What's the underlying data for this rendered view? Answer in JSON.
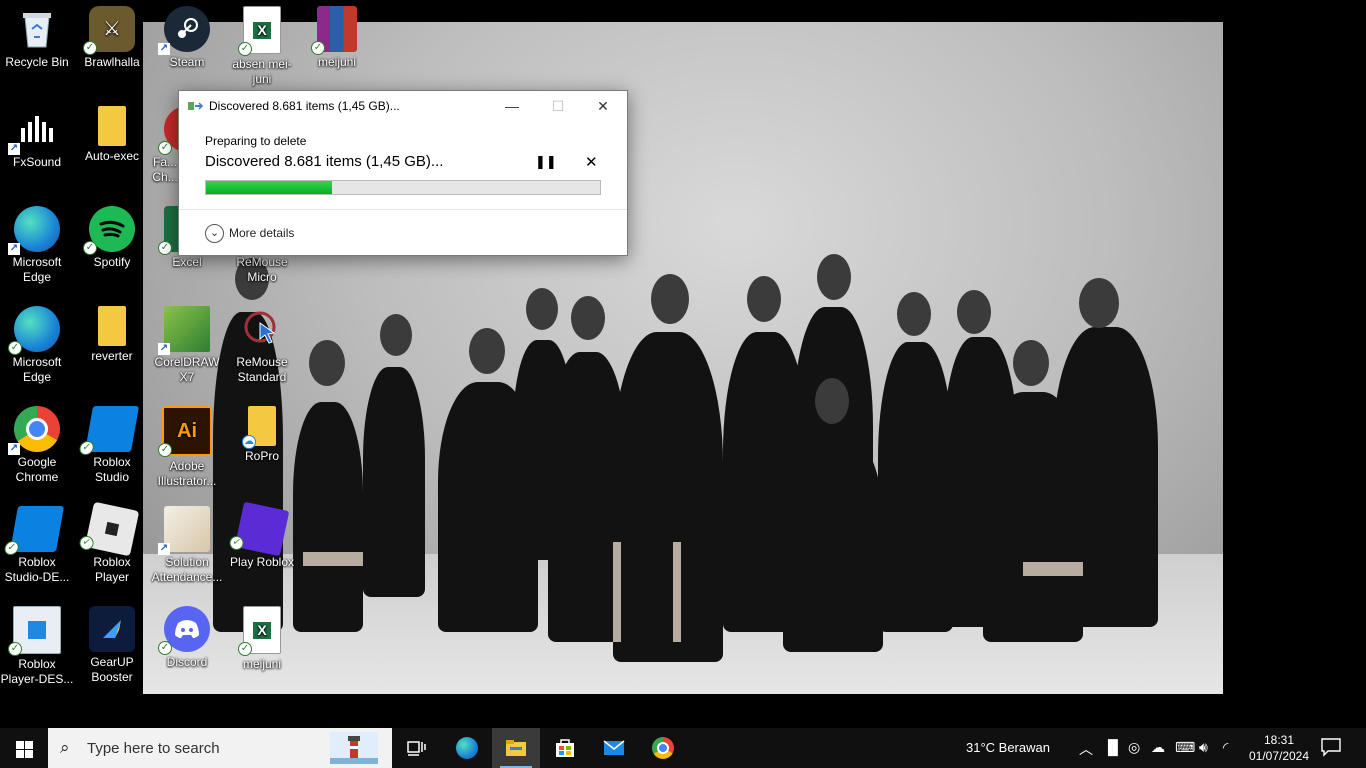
{
  "desktop_icons": [
    {
      "label": "Recycle Bin",
      "icon": "recycle-bin-icon"
    },
    {
      "label": "Brawlhalla",
      "icon": "brawlhalla-icon"
    },
    {
      "label": "Steam",
      "icon": "steam-icon"
    },
    {
      "label": "absen mei-juni",
      "icon": "excel-file-icon"
    },
    {
      "label": "meijuni",
      "icon": "winrar-icon"
    },
    {
      "label": "FxSound",
      "icon": "fxsound-icon"
    },
    {
      "label": "Auto-exec",
      "icon": "folder-icon"
    },
    {
      "label": "Fa... Ch...",
      "icon": "chrome-app-icon"
    },
    {
      "label": "Microsoft Edge",
      "icon": "edge-icon"
    },
    {
      "label": "Spotify",
      "icon": "spotify-icon"
    },
    {
      "label": "Excel",
      "icon": "excel-icon"
    },
    {
      "label": "ReMouse Micro",
      "icon": "remouse-icon"
    },
    {
      "label": "Microsoft Edge",
      "icon": "edge-icon"
    },
    {
      "label": "reverter",
      "icon": "folder-icon"
    },
    {
      "label": "CorelDRAW X7",
      "icon": "coreldraw-icon"
    },
    {
      "label": "ReMouse Standard",
      "icon": "remouse-icon"
    },
    {
      "label": "Google Chrome",
      "icon": "chrome-icon"
    },
    {
      "label": "Roblox Studio",
      "icon": "roblox-studio-icon"
    },
    {
      "label": "Adobe Illustrator...",
      "icon": "illustrator-icon"
    },
    {
      "label": "RoPro",
      "icon": "folder-icon"
    },
    {
      "label": "Roblox Studio-DE...",
      "icon": "roblox-studio-icon"
    },
    {
      "label": "Roblox Player",
      "icon": "roblox-player-icon"
    },
    {
      "label": "Solution Attendance...",
      "icon": "solution-attendance-icon"
    },
    {
      "label": "Play Roblox",
      "icon": "roblox-icon"
    },
    {
      "label": "Roblox Player-DES...",
      "icon": "roblox-player-desktop-icon"
    },
    {
      "label": "GearUP Booster",
      "icon": "gearup-icon"
    },
    {
      "label": "Discord",
      "icon": "discord-icon"
    },
    {
      "label": "meijuni",
      "icon": "excel-file-icon"
    }
  ],
  "dialog": {
    "title": "Discovered 8.681 items (1,45 GB)...",
    "subtitle": "Preparing to delete",
    "status": "Discovered 8.681 items (1,45 GB)...",
    "progress_percent": 32,
    "more_details": "More details",
    "minimize": "—",
    "maximize": "☐",
    "close": "✕",
    "pause": "❚❚",
    "cancel": "✕"
  },
  "taskbar": {
    "search_placeholder": "Type here to search",
    "apps": [
      "task-view",
      "edge",
      "file-explorer",
      "microsoft-store",
      "mail",
      "chrome"
    ],
    "active_app": "file-explorer",
    "weather": "31°C  Berawan",
    "time": "18:31",
    "date": "01/07/2024"
  },
  "colors": {
    "progress": "#06b025",
    "taskbar": "#101010",
    "accent": "#76b9ed"
  }
}
